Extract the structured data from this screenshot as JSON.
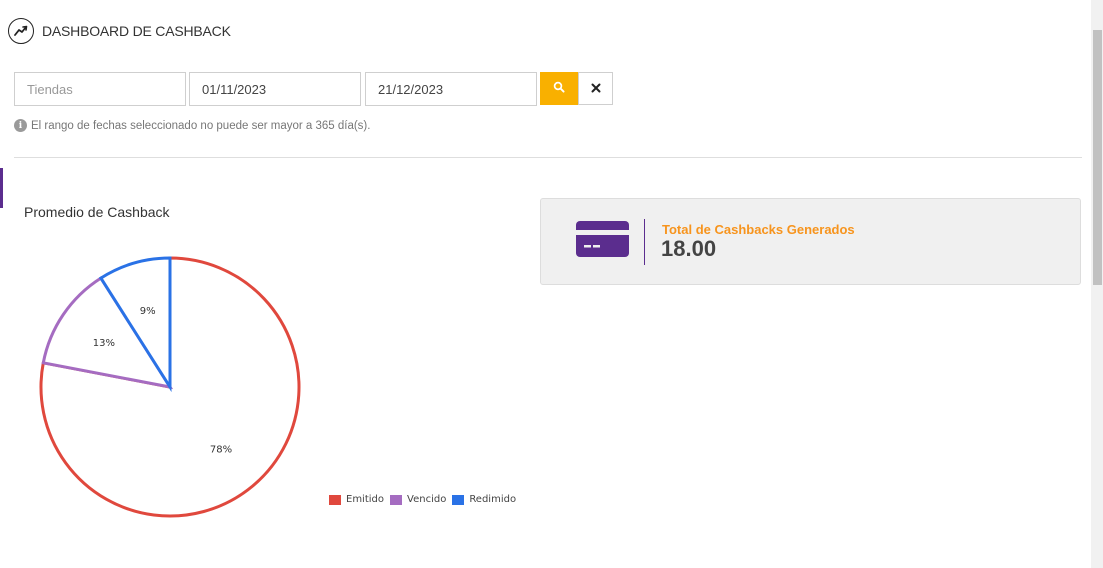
{
  "header": {
    "title": "DASHBOARD DE CASHBACK",
    "icon": "trending-up-icon"
  },
  "filters": {
    "stores_placeholder": "Tiendas",
    "stores_value": "",
    "date_from": "01/11/2023",
    "date_to": "21/12/2023",
    "search_icon": "search-icon",
    "clear_icon": "close-icon",
    "search_button_color": "#f9b000"
  },
  "hint": {
    "icon": "info-icon",
    "text": "El rango de fechas seleccionado no puede ser mayor a 365 día(s)."
  },
  "summary_card": {
    "icon": "credit-card-icon",
    "label": "Total de Cashbacks Generados",
    "value": "18.00",
    "label_color": "#f7941d",
    "accent_color": "#5b2d8e"
  },
  "chart_data": {
    "type": "pie",
    "title": "Promedio de Cashback",
    "categories": [
      "Emitido",
      "Vencido",
      "Redimido"
    ],
    "values": [
      78,
      13,
      9
    ],
    "labels": [
      "78%",
      "13%",
      "9%"
    ],
    "colors": [
      "#e0483d",
      "#a56cc1",
      "#2a72e6"
    ],
    "legend": "bottom-right"
  }
}
